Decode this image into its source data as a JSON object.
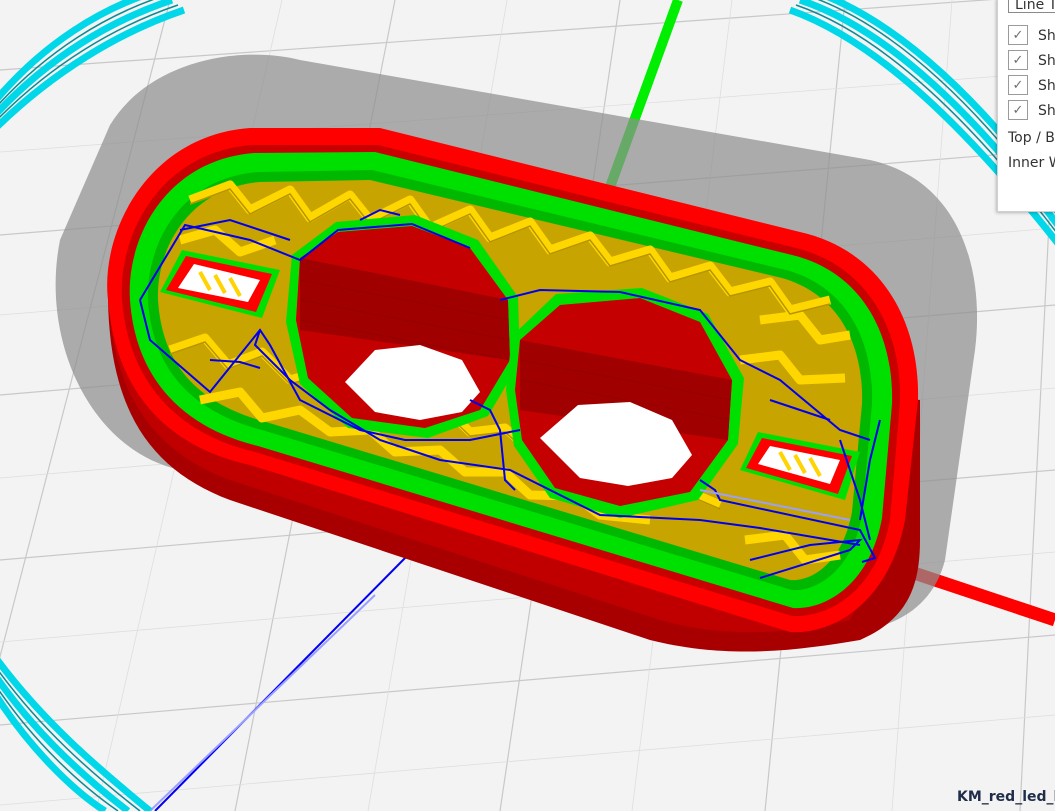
{
  "viewport": {
    "background": "#f3f3f3",
    "colors": {
      "shell": "#ff0000",
      "shell_dark": "#9e0000",
      "inner_wall": "#00ee00",
      "infill": "#ffd400",
      "travel": "#0000ee",
      "skirt": "#00d7e8",
      "axis_y": "#00ee00",
      "axis_x": "#ff0000",
      "axis_z": "#0000ff",
      "shadow": "#a6a6a6"
    }
  },
  "view_panel": {
    "view_type_dropdown": "Line Type",
    "checkboxes": [
      {
        "label": "Show Travels",
        "checked": true
      },
      {
        "label": "Show Helpers",
        "checked": true
      },
      {
        "label": "Show Shell",
        "checked": true
      },
      {
        "label": "Show Infill",
        "checked": true
      }
    ],
    "top_bottom_label": "Top / Bottom",
    "inner_wall_label": "Inner Wall"
  },
  "filename": "KM_red_led_holder"
}
